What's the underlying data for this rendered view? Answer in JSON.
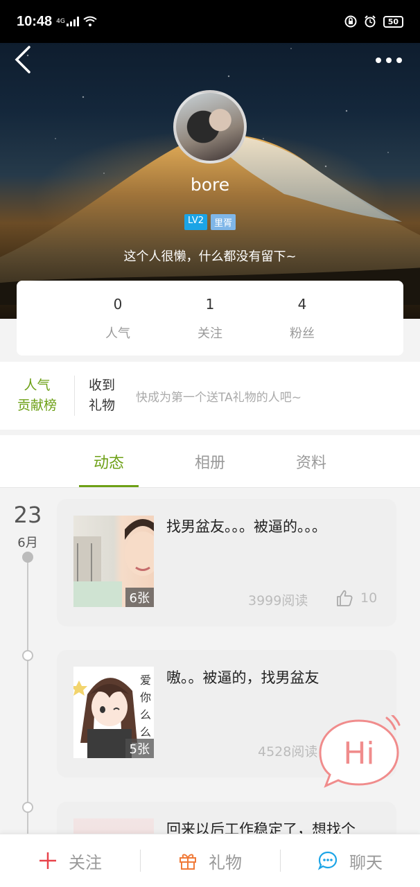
{
  "status_bar": {
    "time": "10:48",
    "network": "4G",
    "battery": "50"
  },
  "profile": {
    "username": "bore",
    "level_badge": "LV2",
    "rank_badge": "里胥",
    "bio": "这个人很懒，什么都没有留下~"
  },
  "stats": [
    {
      "value": "0",
      "label": "人气"
    },
    {
      "value": "1",
      "label": "关注"
    },
    {
      "value": "4",
      "label": "粉丝"
    }
  ],
  "gifts": {
    "rank_label_line1": "人气",
    "rank_label_line2": "贡献榜",
    "received_line1": "收到",
    "received_line2": "礼物",
    "hint": "快成为第一个送TA礼物的人吧~"
  },
  "tabs": [
    "动态",
    "相册",
    "资料"
  ],
  "active_tab": 0,
  "feed": {
    "date_day": "23",
    "date_month": "6月",
    "posts": [
      {
        "title": "找男盆友。。。被逼的。。。",
        "photo_count": "6张",
        "reads": "3999阅读",
        "likes": "10"
      },
      {
        "title": "嗷。。被逼的，找男盆友",
        "photo_count": "5张",
        "reads": "4528阅读",
        "likes": ""
      },
      {
        "title": "回来以后工作稳定了，想找个",
        "photo_count": "",
        "reads": "",
        "likes": ""
      }
    ]
  },
  "bottom_bar": {
    "follow": "关注",
    "gift": "礼物",
    "chat": "聊天"
  },
  "floating_button": {
    "label": "Hi"
  },
  "colors": {
    "accent_green": "#6da016",
    "follow_red": "#e8434b",
    "gift_orange": "#f07a38",
    "chat_blue": "#1ba4e6",
    "hi_pink": "#f08c8c"
  }
}
